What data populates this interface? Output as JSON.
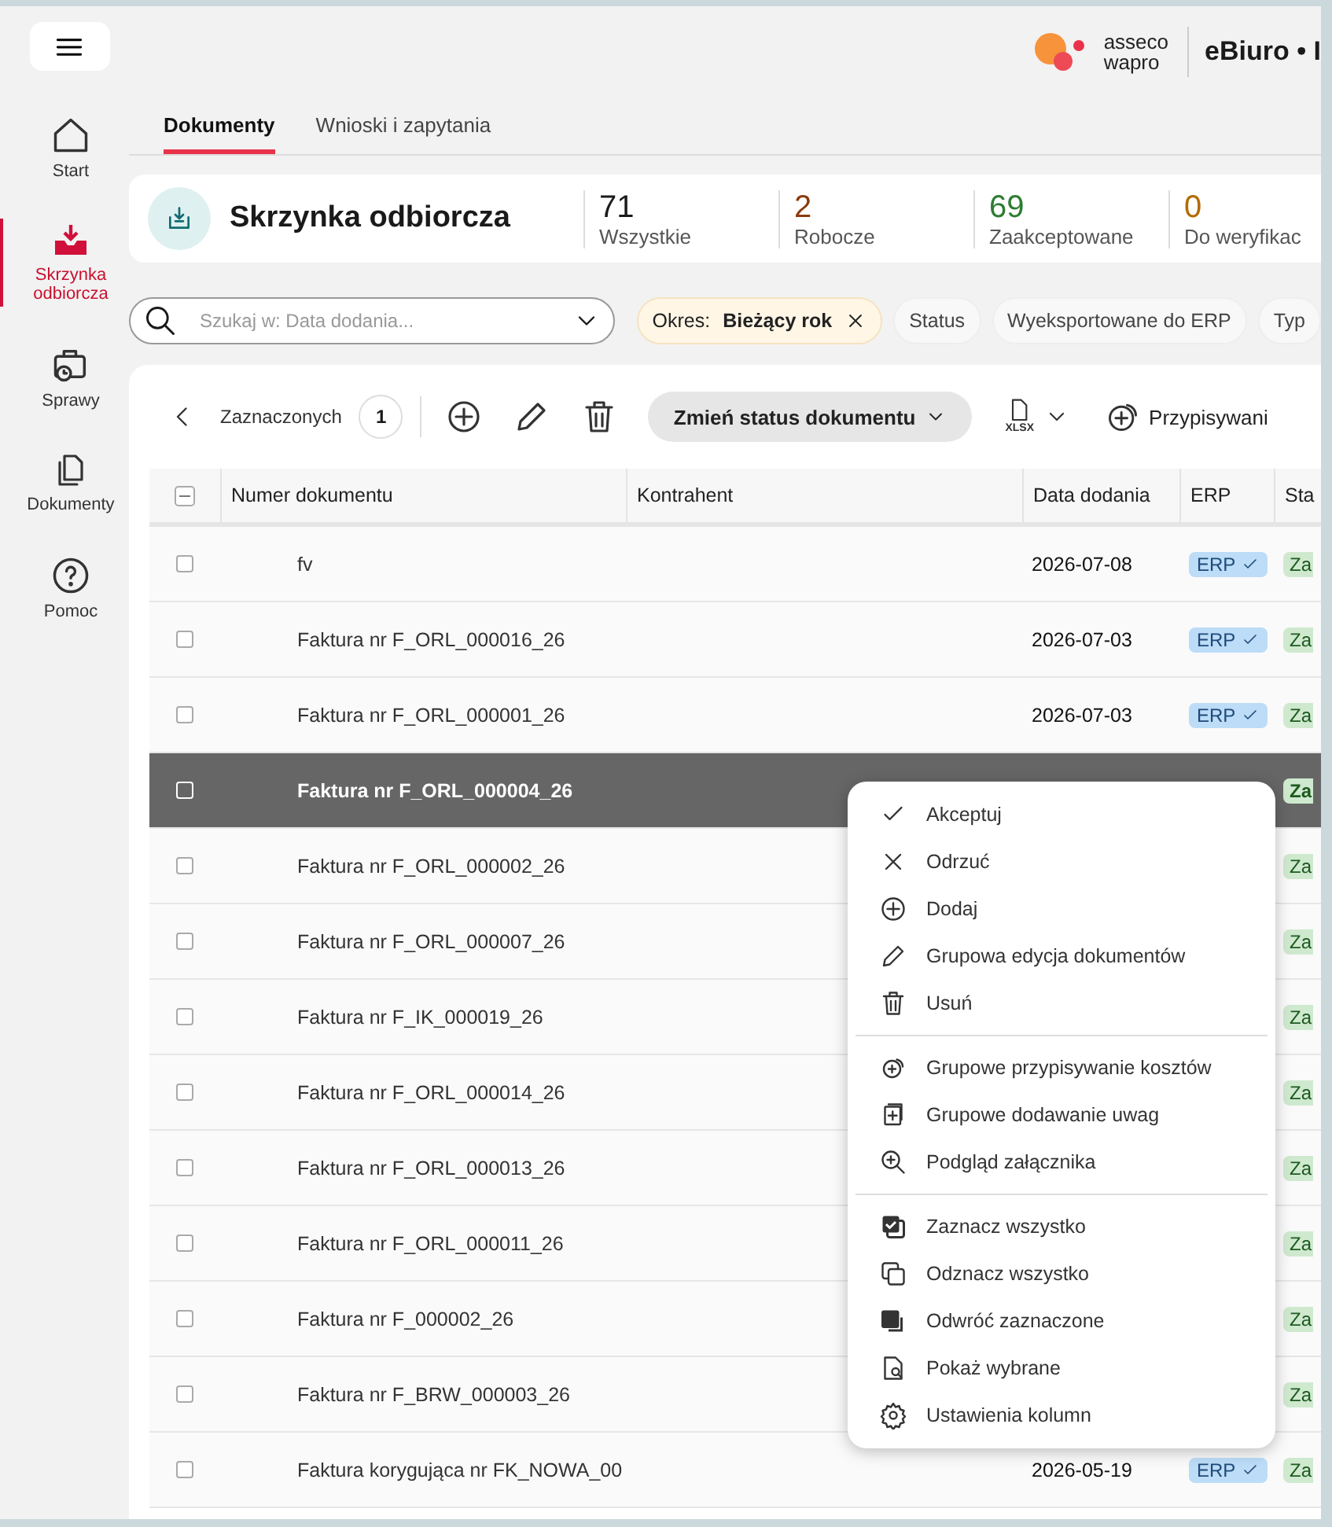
{
  "header": {
    "brand_top": "asseco",
    "brand_bottom": "wapro",
    "app_title": "eBiuro • I"
  },
  "sidebar": {
    "items": [
      {
        "kind": "home",
        "label": "Start",
        "selected": false
      },
      {
        "kind": "inbox",
        "label": "Skrzynka odbiorcza",
        "selected": true
      },
      {
        "kind": "cases",
        "label": "Sprawy",
        "selected": false
      },
      {
        "kind": "documents",
        "label": "Dokumenty",
        "selected": false
      },
      {
        "kind": "help",
        "label": "Pomoc",
        "selected": false
      }
    ]
  },
  "tabs": [
    {
      "label": "Dokumenty",
      "selected": true
    },
    {
      "label": "Wnioski i zapytania",
      "selected": false
    }
  ],
  "inbox": {
    "title": "Skrzynka odbiorcza",
    "stats": [
      {
        "value": "71",
        "label": "Wszystkie",
        "color": "#1a1a1a"
      },
      {
        "value": "2",
        "label": "Robocze",
        "color": "#8a3b0c"
      },
      {
        "value": "69",
        "label": "Zaakceptowane",
        "color": "#2e7d32"
      },
      {
        "value": "0",
        "label": "Do weryfikac",
        "color": "#b36b00"
      }
    ]
  },
  "search": {
    "placeholder": "Szukaj w: Data dodania..."
  },
  "filters": [
    {
      "kind": "active",
      "label": "Okres: **Bieżący rok**"
    },
    {
      "kind": "plain",
      "label": "Status"
    },
    {
      "kind": "plain",
      "label": "Wyeksportowane do ERP"
    },
    {
      "kind": "plain",
      "label": "Typ"
    }
  ],
  "toolbar": {
    "selected_label": "Zaznaczonych",
    "selected_count": "1",
    "status_button": "Zmień status dokumentu",
    "export_label": "XLSX",
    "assign_label": "Przypisywani"
  },
  "table": {
    "select_all": {
      "indeterminate": true
    },
    "columns": [
      "Numer dokumentu",
      "Kontrahent",
      "Data dodania",
      "ERP",
      "Sta"
    ],
    "rows": [
      {
        "number": "fv",
        "date": "2026-07-08",
        "erp": "ERP",
        "status": "Za",
        "selected": false,
        "checked": false
      },
      {
        "number": "Faktura nr F_ORL_000016_26",
        "date": "2026-07-03",
        "erp": "ERP",
        "status": "Za",
        "selected": false,
        "checked": false
      },
      {
        "number": "Faktura nr F_ORL_000001_26",
        "date": "2026-07-03",
        "erp": "ERP",
        "status": "Za",
        "selected": false,
        "checked": false
      },
      {
        "number": "Faktura nr F_ORL_000004_26",
        "status": "Za",
        "selected": true,
        "checked": false
      },
      {
        "number": "Faktura nr F_ORL_000002_26",
        "status": "Za",
        "selected": false,
        "checked": false
      },
      {
        "number": "Faktura nr F_ORL_000007_26",
        "status": "Za",
        "selected": false,
        "checked": false
      },
      {
        "number": "Faktura nr F_IK_000019_26",
        "status": "Za",
        "selected": false,
        "checked": false
      },
      {
        "number": "Faktura nr F_ORL_000014_26",
        "status": "Za",
        "selected": false,
        "checked": false
      },
      {
        "number": "Faktura nr F_ORL_000013_26",
        "status": "Za",
        "selected": false,
        "checked": false
      },
      {
        "number": "Faktura nr F_ORL_000011_26",
        "status": "Za",
        "selected": false,
        "checked": false
      },
      {
        "number": "Faktura nr F_000002_26",
        "status": "Za",
        "selected": false,
        "checked": false
      },
      {
        "number": "Faktura nr F_BRW_000003_26",
        "status": "Za",
        "selected": false,
        "checked": false
      },
      {
        "number": "Faktura korygująca nr FK_NOWA_00",
        "date": "2026-05-19",
        "erp": "ERP",
        "status": "Za",
        "selected": false,
        "checked": false
      }
    ]
  },
  "context_menu": {
    "groups": [
      [
        {
          "kind": "check",
          "label": "Akceptuj"
        },
        {
          "kind": "cross",
          "label": "Odrzuć"
        },
        {
          "kind": "plus",
          "label": "Dodaj"
        },
        {
          "kind": "pencil",
          "label": "Grupowa edycja dokumentów"
        },
        {
          "kind": "trash",
          "label": "Usuń"
        }
      ],
      [
        {
          "kind": "assign",
          "label": "Grupowe przypisywanie kosztów"
        },
        {
          "kind": "note",
          "label": "Grupowe dodawanie uwag"
        },
        {
          "kind": "zoom",
          "label": "Podgląd załącznika"
        }
      ],
      [
        {
          "kind": "select-all",
          "label": "Zaznacz wszystko"
        },
        {
          "kind": "deselect",
          "label": "Odznacz wszystko"
        },
        {
          "kind": "invert",
          "label": "Odwróć zaznaczone"
        },
        {
          "kind": "show",
          "label": "Pokaż wybrane"
        },
        {
          "kind": "gear",
          "label": "Ustawienia kolumn"
        }
      ]
    ]
  }
}
